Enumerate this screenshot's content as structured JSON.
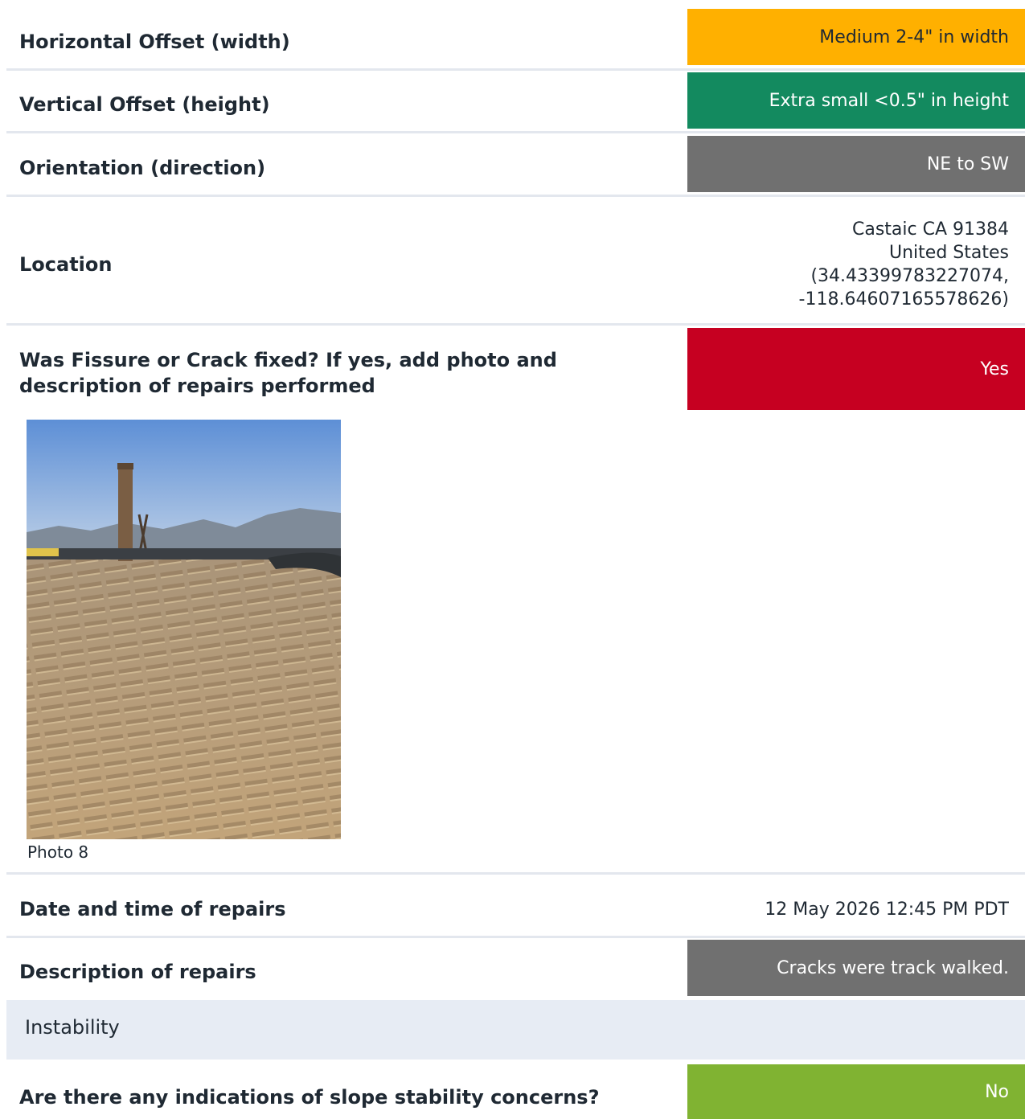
{
  "rows": {
    "horizontal": {
      "label": "Horizontal Offset (width)",
      "value": "Medium 2-4\" in width",
      "color": "#FFB000"
    },
    "vertical": {
      "label": "Vertical Offset (height)",
      "value": "Extra small <0.5\" in height",
      "color": "#138A5F"
    },
    "orientation": {
      "label": "Orientation (direction)",
      "value": "NE to SW",
      "color": "#707070"
    },
    "location": {
      "label": "Location",
      "line1": "Castaic CA 91384",
      "line2": "United States",
      "line3": "(34.43399783227074,",
      "line4": "-118.64607165578626)"
    },
    "fixed": {
      "label": "Was Fissure or Crack fixed? If yes, add photo and description of repairs performed",
      "value": "Yes",
      "color": "#C60021"
    },
    "photo": {
      "caption": "Photo 8"
    },
    "date": {
      "label": "Date and time of repairs",
      "value": "12 May 2026 12:45 PM PDT"
    },
    "description": {
      "label": "Description of repairs",
      "value": "Cracks were track walked.",
      "color": "#707070"
    }
  },
  "section": {
    "title": "Instability"
  },
  "slope": {
    "label": "Are there any indications of slope stability concerns?",
    "value": "No",
    "color": "#80B332"
  }
}
